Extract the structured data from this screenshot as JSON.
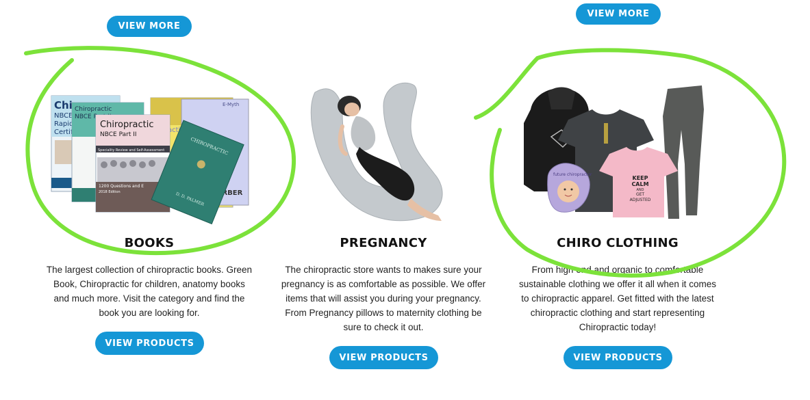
{
  "top_buttons": {
    "left_label": "VIEW MORE",
    "right_label": "VIEW MORE"
  },
  "categories": [
    {
      "title": "BOOKS",
      "lines": [
        "The largest collection of chiropractic books. Green",
        "Book, Chiropractic for children, anatomy books",
        "and much more. Visit the category and find the",
        "book you are looking for."
      ],
      "button": "VIEW PRODUCTS",
      "book_texts": {
        "back_title": "Chiro",
        "back_sub1": "NBCE",
        "back_sub2": "Rapid",
        "back_sub3": "Certifi",
        "mid_title": "Chiropractic",
        "mid_sub": "NBCE Part II",
        "front_title": "Chiropractic",
        "front_sub": "NBCE Part II",
        "front_desc": "Speciality Review and Self-Assessment",
        "front_bottom": "1200 Questions and E",
        "front_edition": "2018 Edition",
        "green_title": "CHIROPRACTIC",
        "green_author": "D. D. PALMER",
        "right_text1": "actic",
        "right_text2": "BERBER",
        "right_text3": "E-Myth"
      }
    },
    {
      "title": "PREGNANCY",
      "lines": [
        "The chiropractic store wants to makes sure your",
        "pregnancy is as comfortable as possible. We offer",
        "items that will assist you during your pregnancy.",
        "From Pregnancy pillows to maternity clothing be",
        "sure to check it out."
      ],
      "button": "VIEW PRODUCTS"
    },
    {
      "title": "CHIRO CLOTHING",
      "lines": [
        "From high end and organic to comfortable",
        "sustainable clothing we offer it all when it comes",
        "to chiropractic apparel. Get fitted with the latest",
        "chiropractic clothing and start representing",
        "Chiropractic today!"
      ],
      "button": "VIEW PRODUCTS",
      "shirt_text": [
        "KEEP",
        "CALM",
        "AND",
        "GET",
        "ADJUSTED"
      ],
      "bib_text": "future chiropractor"
    }
  ],
  "colors": {
    "button": "#1597d6",
    "highlight": "#7ce23a",
    "text": "#222222"
  }
}
